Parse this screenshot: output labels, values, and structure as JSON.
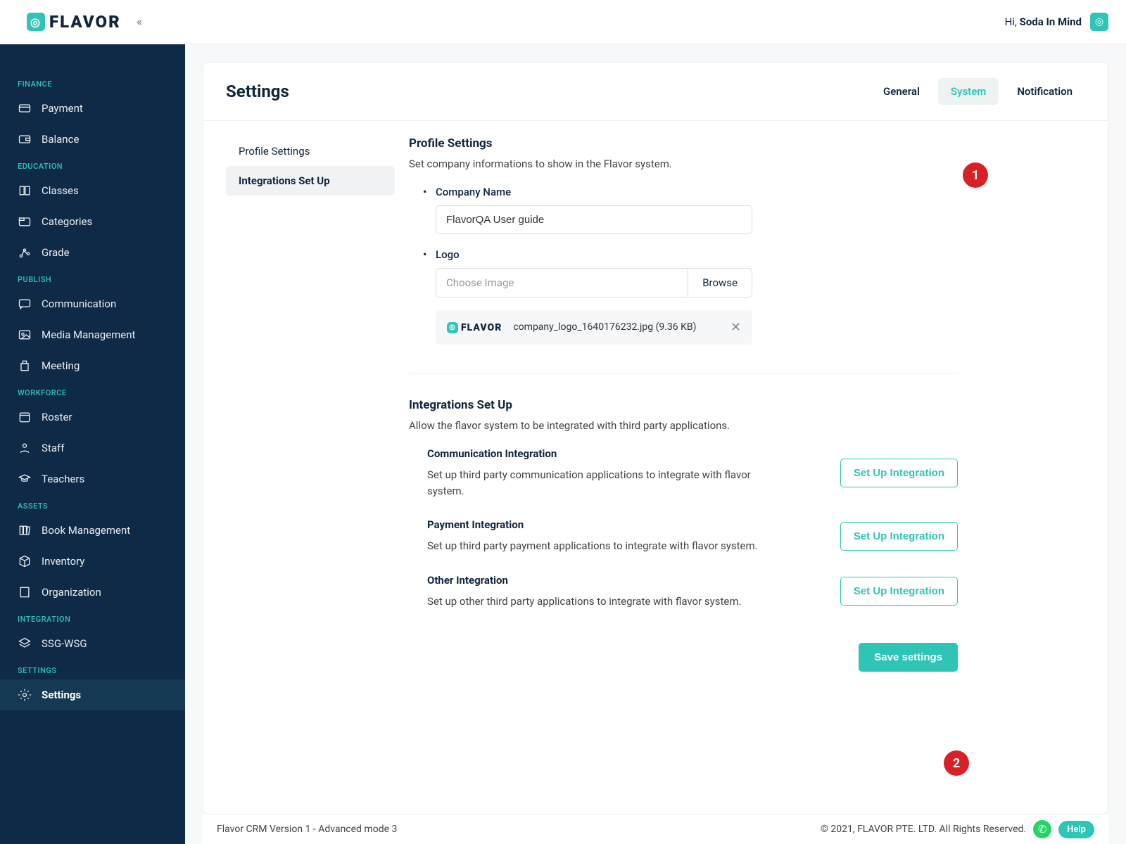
{
  "header": {
    "brand": "FLAVOR",
    "greeting_prefix": "Hi, ",
    "user_name": "Soda In Mind"
  },
  "sidebar": {
    "sections": [
      {
        "title": "FINANCE",
        "items": [
          {
            "label": "Payment",
            "icon": "card"
          },
          {
            "label": "Balance",
            "icon": "wallet"
          }
        ]
      },
      {
        "title": "EDUCATION",
        "items": [
          {
            "label": "Classes",
            "icon": "book"
          },
          {
            "label": "Categories",
            "icon": "folder"
          },
          {
            "label": "Grade",
            "icon": "graph"
          }
        ]
      },
      {
        "title": "PUBLISH",
        "items": [
          {
            "label": "Communication",
            "icon": "chat"
          },
          {
            "label": "Media Management",
            "icon": "media"
          },
          {
            "label": "Meeting",
            "icon": "podium"
          }
        ]
      },
      {
        "title": "WORKFORCE",
        "items": [
          {
            "label": "Roster",
            "icon": "calendar"
          },
          {
            "label": "Staff",
            "icon": "person"
          },
          {
            "label": "Teachers",
            "icon": "cap"
          }
        ]
      },
      {
        "title": "ASSETS",
        "items": [
          {
            "label": "Book Management",
            "icon": "books"
          },
          {
            "label": "Inventory",
            "icon": "box"
          },
          {
            "label": "Organization",
            "icon": "building"
          }
        ]
      },
      {
        "title": "INTEGRATION",
        "items": [
          {
            "label": "SSG-WSG",
            "icon": "layers"
          }
        ]
      },
      {
        "title": "SETTINGS",
        "items": [
          {
            "label": "Settings",
            "icon": "gear",
            "active": true
          }
        ]
      }
    ]
  },
  "page": {
    "title": "Settings",
    "tabs": [
      {
        "label": "General"
      },
      {
        "label": "System",
        "active": true
      },
      {
        "label": "Notification"
      }
    ],
    "subnav": [
      {
        "label": "Profile Settings"
      },
      {
        "label": "Integrations Set Up",
        "active": true
      }
    ]
  },
  "profile": {
    "heading": "Profile Settings",
    "sub": "Set company informations to show in the Flavor system.",
    "company_name_label": "Company Name",
    "company_name_value": "FlavorQA User guide",
    "logo_label": "Logo",
    "choose_placeholder": "Choose Image",
    "browse": "Browse",
    "file_name": "company_logo_1640176232.jpg (9.36 KB)",
    "preview_brand": "FLAVOR"
  },
  "integrations": {
    "heading": "Integrations Set Up",
    "sub": "Allow the flavor system to be integrated with third party applications.",
    "items": [
      {
        "title": "Communication Integration",
        "desc": "Set up third party communication applications to integrate with flavor system.",
        "btn": "Set Up Integration"
      },
      {
        "title": "Payment Integration",
        "desc": "Set up third party payment applications to integrate with flavor system.",
        "btn": "Set Up Integration"
      },
      {
        "title": "Other Integration",
        "desc": "Set up other third party applications to integrate with flavor system.",
        "btn": "Set Up Integration"
      }
    ],
    "save": "Save settings"
  },
  "footer": {
    "left": "Flavor CRM Version 1 - Advanced mode 3",
    "right": "© 2021, FLAVOR PTE. LTD. All Rights Reserved.",
    "help": "Help"
  },
  "callouts": {
    "c1": "1",
    "c2": "2"
  }
}
